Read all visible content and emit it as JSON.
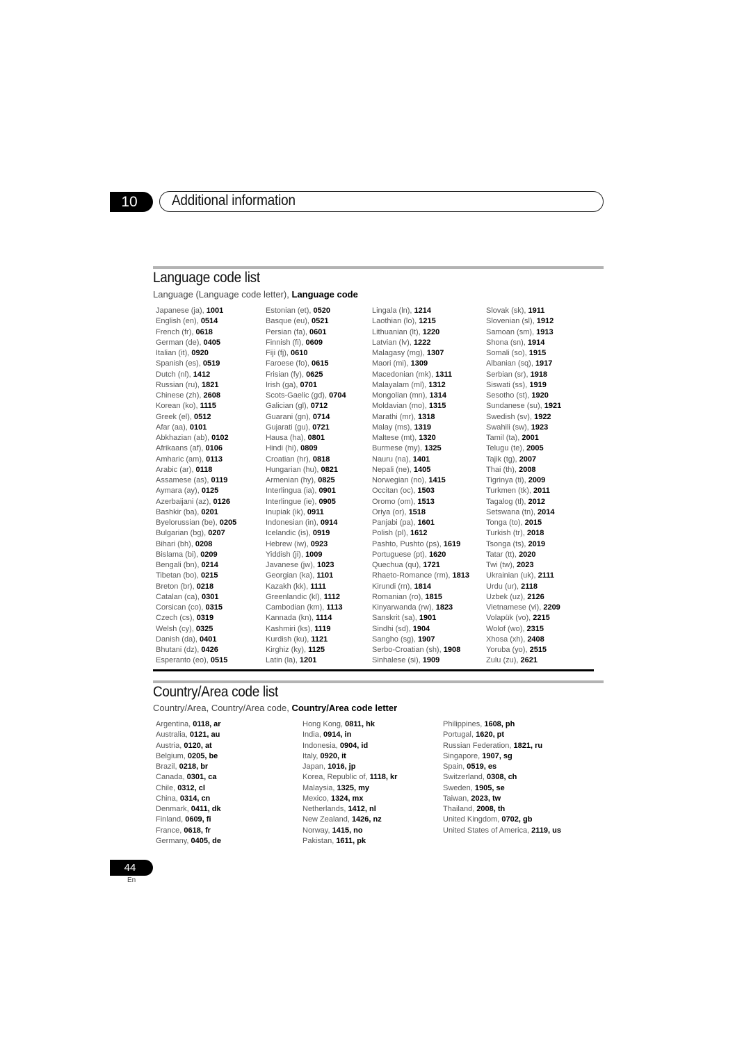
{
  "header": {
    "chapter_number": "10",
    "chapter_title": "Additional information"
  },
  "language_section": {
    "title": "Language code list",
    "subtitle_normal": "Language (Language code letter), ",
    "subtitle_bold": "Language code",
    "columns": [
      [
        {
          "name": "Japanese (ja), ",
          "code": "1001"
        },
        {
          "name": "English (en), ",
          "code": "0514"
        },
        {
          "name": "French (fr), ",
          "code": "0618"
        },
        {
          "name": "German (de), ",
          "code": "0405"
        },
        {
          "name": "Italian (it), ",
          "code": "0920"
        },
        {
          "name": "Spanish (es), ",
          "code": "0519"
        },
        {
          "name": "Dutch (nl), ",
          "code": "1412"
        },
        {
          "name": "Russian (ru), ",
          "code": "1821"
        },
        {
          "name": "Chinese (zh), ",
          "code": "2608"
        },
        {
          "name": "Korean (ko), ",
          "code": "1115"
        },
        {
          "name": "Greek (el), ",
          "code": "0512"
        },
        {
          "name": "Afar (aa), ",
          "code": "0101"
        },
        {
          "name": "Abkhazian (ab), ",
          "code": "0102"
        },
        {
          "name": "Afrikaans (af), ",
          "code": "0106"
        },
        {
          "name": "Amharic (am), ",
          "code": "0113"
        },
        {
          "name": "Arabic (ar), ",
          "code": "0118"
        },
        {
          "name": "Assamese (as), ",
          "code": "0119"
        },
        {
          "name": "Aymara (ay), ",
          "code": "0125"
        },
        {
          "name": "Azerbaijani (az), ",
          "code": "0126"
        },
        {
          "name": "Bashkir (ba), ",
          "code": "0201"
        },
        {
          "name": "Byelorussian (be), ",
          "code": "0205"
        },
        {
          "name": "Bulgarian (bg), ",
          "code": "0207"
        },
        {
          "name": "Bihari (bh), ",
          "code": "0208"
        },
        {
          "name": "Bislama (bi), ",
          "code": "0209"
        },
        {
          "name": "Bengali (bn), ",
          "code": "0214"
        },
        {
          "name": "Tibetan (bo), ",
          "code": "0215"
        },
        {
          "name": "Breton (br), ",
          "code": "0218"
        },
        {
          "name": "Catalan (ca), ",
          "code": "0301"
        },
        {
          "name": "Corsican (co), ",
          "code": "0315"
        },
        {
          "name": "Czech (cs), ",
          "code": "0319"
        },
        {
          "name": "Welsh (cy), ",
          "code": "0325"
        },
        {
          "name": "Danish (da), ",
          "code": "0401"
        },
        {
          "name": "Bhutani (dz), ",
          "code": "0426"
        },
        {
          "name": "Esperanto (eo), ",
          "code": "0515"
        }
      ],
      [
        {
          "name": "Estonian (et), ",
          "code": "0520"
        },
        {
          "name": "Basque (eu), ",
          "code": "0521"
        },
        {
          "name": "Persian (fa), ",
          "code": "0601"
        },
        {
          "name": "Finnish (fi), ",
          "code": "0609"
        },
        {
          "name": "Fiji (fj), ",
          "code": "0610"
        },
        {
          "name": "Faroese (fo), ",
          "code": "0615"
        },
        {
          "name": "Frisian (fy), ",
          "code": "0625"
        },
        {
          "name": "Irish (ga), ",
          "code": "0701"
        },
        {
          "name": "Scots-Gaelic (gd), ",
          "code": "0704"
        },
        {
          "name": "Galician (gl), ",
          "code": "0712"
        },
        {
          "name": "Guarani (gn), ",
          "code": "0714"
        },
        {
          "name": "Gujarati (gu), ",
          "code": "0721"
        },
        {
          "name": "Hausa (ha), ",
          "code": "0801"
        },
        {
          "name": "Hindi (hi), ",
          "code": "0809"
        },
        {
          "name": "Croatian (hr), ",
          "code": "0818"
        },
        {
          "name": "Hungarian (hu), ",
          "code": "0821"
        },
        {
          "name": "Armenian (hy), ",
          "code": "0825"
        },
        {
          "name": "Interlingua (ia), ",
          "code": "0901"
        },
        {
          "name": "Interlingue (ie), ",
          "code": "0905"
        },
        {
          "name": "Inupiak (ik), ",
          "code": "0911"
        },
        {
          "name": "Indonesian (in), ",
          "code": "0914"
        },
        {
          "name": "Icelandic (is), ",
          "code": "0919"
        },
        {
          "name": "Hebrew (iw), ",
          "code": "0923"
        },
        {
          "name": "Yiddish (ji), ",
          "code": "1009"
        },
        {
          "name": "Javanese (jw), ",
          "code": "1023"
        },
        {
          "name": "Georgian (ka), ",
          "code": "1101"
        },
        {
          "name": "Kazakh (kk), ",
          "code": "1111"
        },
        {
          "name": "Greenlandic  (kl), ",
          "code": "1112"
        },
        {
          "name": "Cambodian (km), ",
          "code": "1113"
        },
        {
          "name": "Kannada (kn), ",
          "code": "1114"
        },
        {
          "name": "Kashmiri (ks), ",
          "code": "1119"
        },
        {
          "name": "Kurdish (ku), ",
          "code": "1121"
        },
        {
          "name": "Kirghiz (ky), ",
          "code": "1125"
        },
        {
          "name": "Latin (la), ",
          "code": "1201"
        }
      ],
      [
        {
          "name": "Lingala (ln), ",
          "code": "1214"
        },
        {
          "name": "Laothian (lo), ",
          "code": "1215"
        },
        {
          "name": "Lithuanian (lt), ",
          "code": "1220"
        },
        {
          "name": "Latvian (lv), ",
          "code": "1222"
        },
        {
          "name": "Malagasy (mg), ",
          "code": "1307"
        },
        {
          "name": "Maori (mi), ",
          "code": "1309"
        },
        {
          "name": "Macedonian (mk), ",
          "code": "1311"
        },
        {
          "name": "Malayalam  (ml), ",
          "code": "1312"
        },
        {
          "name": "Mongolian (mn), ",
          "code": "1314"
        },
        {
          "name": "Moldavian (mo), ",
          "code": "1315"
        },
        {
          "name": "Marathi (mr), ",
          "code": "1318"
        },
        {
          "name": "Malay  (ms), ",
          "code": "1319"
        },
        {
          "name": "Maltese (mt), ",
          "code": "1320"
        },
        {
          "name": "Burmese (my), ",
          "code": "1325"
        },
        {
          "name": "Nauru (na), ",
          "code": "1401"
        },
        {
          "name": "Nepali (ne), ",
          "code": "1405"
        },
        {
          "name": "Norwegian (no), ",
          "code": "1415"
        },
        {
          "name": "Occitan (oc), ",
          "code": "1503"
        },
        {
          "name": "Oromo (om), ",
          "code": "1513"
        },
        {
          "name": "Oriya (or), ",
          "code": "1518"
        },
        {
          "name": "Panjabi (pa), ",
          "code": "1601"
        },
        {
          "name": "Polish (pl), ",
          "code": "1612"
        },
        {
          "name": "Pashto, Pushto (ps), ",
          "code": "1619"
        },
        {
          "name": "Portuguese (pt), ",
          "code": "1620"
        },
        {
          "name": "Quechua (qu), ",
          "code": "1721"
        },
        {
          "name": "Rhaeto-Romance (rm), ",
          "code": "1813"
        },
        {
          "name": "Kirundi (rn), ",
          "code": "1814"
        },
        {
          "name": "Romanian (ro), ",
          "code": "1815"
        },
        {
          "name": "Kinyarwanda (rw), ",
          "code": "1823"
        },
        {
          "name": "Sanskrit (sa), ",
          "code": "1901"
        },
        {
          "name": "Sindhi (sd), ",
          "code": "1904"
        },
        {
          "name": "Sangho (sg), ",
          "code": "1907"
        },
        {
          "name": "Serbo-Croatian (sh), ",
          "code": "1908"
        },
        {
          "name": "Sinhalese (si), ",
          "code": "1909"
        }
      ],
      [
        {
          "name": "Slovak (sk), ",
          "code": "1911"
        },
        {
          "name": "Slovenian (sl), ",
          "code": "1912"
        },
        {
          "name": "Samoan (sm), ",
          "code": "1913"
        },
        {
          "name": "Shona (sn), ",
          "code": "1914"
        },
        {
          "name": "Somali (so), ",
          "code": "1915"
        },
        {
          "name": "Albanian (sq), ",
          "code": "1917"
        },
        {
          "name": "Serbian (sr), ",
          "code": "1918"
        },
        {
          "name": "Siswati (ss), ",
          "code": "1919"
        },
        {
          "name": "Sesotho (st), ",
          "code": "1920"
        },
        {
          "name": "Sundanese (su), ",
          "code": "1921"
        },
        {
          "name": "Swedish (sv), ",
          "code": "1922"
        },
        {
          "name": "Swahili (sw), ",
          "code": "1923"
        },
        {
          "name": "Tamil (ta), ",
          "code": "2001"
        },
        {
          "name": "Telugu (te), ",
          "code": "2005"
        },
        {
          "name": "Tajik (tg), ",
          "code": "2007"
        },
        {
          "name": "Thai (th), ",
          "code": "2008"
        },
        {
          "name": "Tigrinya (ti), ",
          "code": "2009"
        },
        {
          "name": "Turkmen (tk), ",
          "code": "2011"
        },
        {
          "name": "Tagalog (tl), ",
          "code": "2012"
        },
        {
          "name": "Setswana (tn), ",
          "code": "2014"
        },
        {
          "name": "Tonga (to), ",
          "code": "2015"
        },
        {
          "name": "Turkish (tr), ",
          "code": "2018"
        },
        {
          "name": "Tsonga (ts), ",
          "code": "2019"
        },
        {
          "name": "Tatar (tt), ",
          "code": "2020"
        },
        {
          "name": "Twi (tw), ",
          "code": "2023"
        },
        {
          "name": "Ukrainian (uk), ",
          "code": "2111"
        },
        {
          "name": "Urdu (ur), ",
          "code": "2118"
        },
        {
          "name": "Uzbek (uz), ",
          "code": "2126"
        },
        {
          "name": "Vietnamese (vi), ",
          "code": "2209"
        },
        {
          "name": "Volapük (vo), ",
          "code": "2215"
        },
        {
          "name": "Wolof (wo), ",
          "code": "2315"
        },
        {
          "name": "Xhosa (xh), ",
          "code": "2408"
        },
        {
          "name": "Yoruba (yo), ",
          "code": "2515"
        },
        {
          "name": "Zulu (zu), ",
          "code": "2621"
        }
      ]
    ]
  },
  "country_section": {
    "title": "Country/Area code list",
    "subtitle_normal": "Country/Area, Country/Area code, ",
    "subtitle_bold": "Country/Area code letter",
    "columns": [
      [
        {
          "name": "Argentina, ",
          "code": "0118, ar"
        },
        {
          "name": "Australia, ",
          "code": "0121, au"
        },
        {
          "name": "Austria, ",
          "code": "0120, at"
        },
        {
          "name": "Belgium, ",
          "code": "0205, be"
        },
        {
          "name": "Brazil, ",
          "code": "0218, br"
        },
        {
          "name": "Canada, ",
          "code": "0301, ca"
        },
        {
          "name": "Chile, ",
          "code": "0312, cl"
        },
        {
          "name": "China, ",
          "code": "0314, cn"
        },
        {
          "name": "Denmark, ",
          "code": "0411, dk"
        },
        {
          "name": "Finland, ",
          "code": "0609, fi"
        },
        {
          "name": "France, ",
          "code": "0618, fr"
        },
        {
          "name": "Germany, ",
          "code": "0405, de"
        }
      ],
      [
        {
          "name": "Hong Kong, ",
          "code": "0811, hk"
        },
        {
          "name": "India, ",
          "code": "0914, in"
        },
        {
          "name": "Indonesia, ",
          "code": "0904, id"
        },
        {
          "name": "Italy, ",
          "code": "0920, it"
        },
        {
          "name": "Japan, ",
          "code": "1016, jp"
        },
        {
          "name": "Korea, Republic of, ",
          "code": "1118, kr"
        },
        {
          "name": "Malaysia, ",
          "code": "1325, my"
        },
        {
          "name": "Mexico, ",
          "code": "1324, mx"
        },
        {
          "name": "Netherlands, ",
          "code": "1412, nl"
        },
        {
          "name": "New Zealand, ",
          "code": "1426, nz"
        },
        {
          "name": "Norway, ",
          "code": "1415, no"
        },
        {
          "name": "Pakistan, ",
          "code": "1611, pk"
        }
      ],
      [
        {
          "name": "Philippines, ",
          "code": "1608, ph"
        },
        {
          "name": "Portugal, ",
          "code": "1620, pt"
        },
        {
          "name": "Russian Federation, ",
          "code": "1821, ru"
        },
        {
          "name": "Singapore, ",
          "code": "1907, sg"
        },
        {
          "name": "Spain, ",
          "code": "0519, es"
        },
        {
          "name": "Switzerland, ",
          "code": "0308, ch"
        },
        {
          "name": "Sweden, ",
          "code": "1905, se"
        },
        {
          "name": "Taiwan, ",
          "code": "2023, tw"
        },
        {
          "name": "Thailand, ",
          "code": "2008, th"
        },
        {
          "name": "United Kingdom, ",
          "code": "0702, gb"
        },
        {
          "name": "United States of America, ",
          "code": "2119, us"
        }
      ]
    ]
  },
  "footer": {
    "page_number": "44",
    "language": "En"
  }
}
